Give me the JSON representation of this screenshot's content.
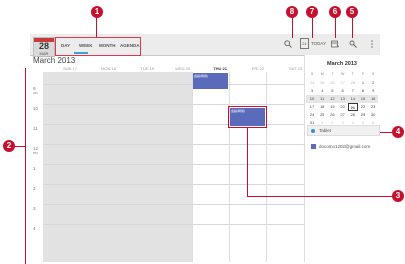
{
  "header": {
    "date_day": "28",
    "date_sub": "MAR",
    "tabs": [
      {
        "label": "DAY"
      },
      {
        "label": "WEEK"
      },
      {
        "label": "MONTH"
      },
      {
        "label": "AGENDA"
      }
    ],
    "today_icon_num": "21",
    "today_label": "TODAY"
  },
  "month_title": "March 2013",
  "week_days": [
    {
      "label": "SUN 17"
    },
    {
      "label": "MON 18"
    },
    {
      "label": "TUE 19"
    },
    {
      "label": "WED 20"
    },
    {
      "label": "THU 21"
    },
    {
      "label": "FRI 22"
    },
    {
      "label": "SAT 23"
    }
  ],
  "hours": [
    {
      "label": "9",
      "ampm": "AM"
    },
    {
      "label": "10",
      "ampm": ""
    },
    {
      "label": "11",
      "ampm": ""
    },
    {
      "label": "12",
      "ampm": "PM"
    },
    {
      "label": "1",
      "ampm": ""
    },
    {
      "label": "2",
      "ampm": ""
    },
    {
      "label": "3",
      "ampm": ""
    },
    {
      "label": "4",
      "ampm": ""
    },
    {
      "label": "5",
      "ampm": ""
    }
  ],
  "events": [
    {
      "title": "会議(時間)"
    },
    {
      "title": "会議(時間)"
    }
  ],
  "mini_calendar": {
    "title": "March 2013",
    "weekday_headers": [
      "S",
      "M",
      "T",
      "W",
      "T",
      "F",
      "S"
    ],
    "weeks": [
      [
        "24",
        "25",
        "26",
        "27",
        "28",
        "1",
        "2"
      ],
      [
        "3",
        "4",
        "5",
        "6",
        "7",
        "8",
        "9"
      ],
      [
        "10",
        "11",
        "12",
        "13",
        "14",
        "15",
        "16"
      ],
      [
        "17",
        "18",
        "19",
        "20",
        "21",
        "22",
        "23"
      ],
      [
        "24",
        "25",
        "26",
        "27",
        "28",
        "29",
        "30"
      ],
      [
        "31",
        "1",
        "2",
        "3",
        "4",
        "5",
        "6"
      ]
    ]
  },
  "calendars": [
    {
      "name": "Tablet"
    },
    {
      "name": "docomo1202@gmail.com"
    }
  ],
  "callouts": [
    "1",
    "2",
    "3",
    "4",
    "5",
    "6",
    "7",
    "8"
  ],
  "colors": {
    "accent": "#c8102e",
    "event": "#5b6bbb",
    "tab_underline": "#3aa0d8"
  }
}
